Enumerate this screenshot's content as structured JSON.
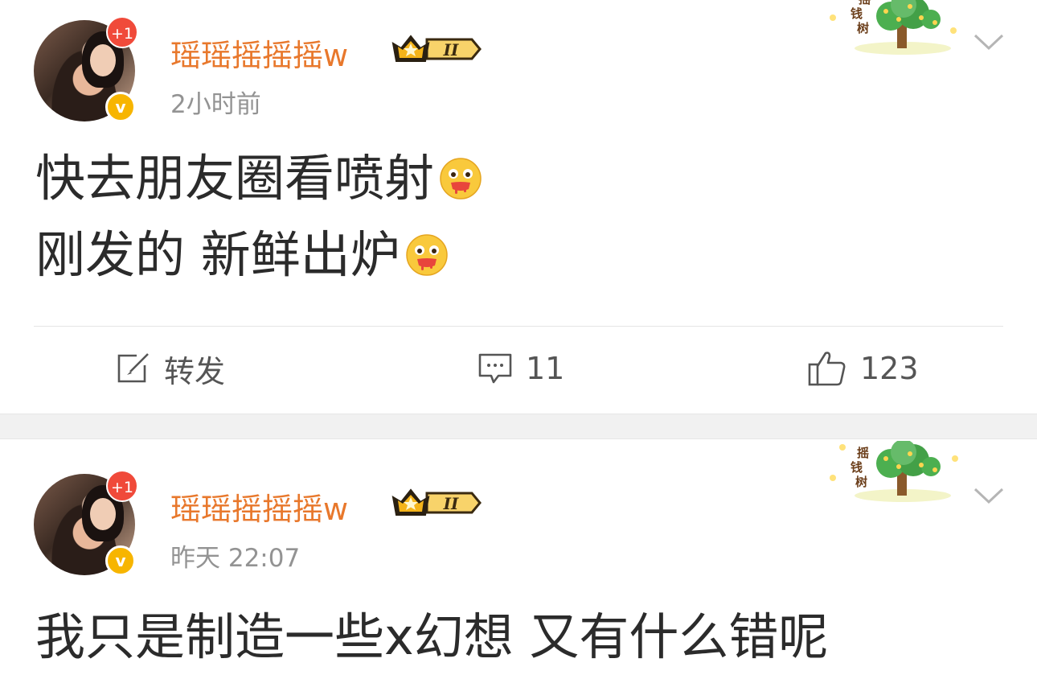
{
  "posts": [
    {
      "username": "瑶瑶摇摇摇w",
      "member_level": "II",
      "avatar_badge": "+1",
      "verified_mark": "v",
      "timestamp": "2小时前",
      "tree_label": [
        "摇",
        "钱",
        "树"
      ],
      "content_line1": "快去朋友圈看喷射",
      "content_line2": "刚发的 新鲜出炉",
      "emoji_icon": "drooling-face-emoji",
      "actions": {
        "repost_label": "转发",
        "comment_count": "11",
        "like_count": "123"
      }
    },
    {
      "username": "瑶瑶摇摇摇w",
      "member_level": "II",
      "avatar_badge": "+1",
      "verified_mark": "v",
      "timestamp": "昨天 22:07",
      "tree_label": [
        "摇",
        "钱",
        "树"
      ],
      "content_line1": "我只是制造一些x幻想 又有什么错呢"
    }
  ],
  "colors": {
    "username": "#e8782c",
    "timestamp": "#939393",
    "badge_red": "#f04a3a",
    "verified_gold": "#f7b500",
    "crown_gold": "#f5b41a"
  },
  "icons": [
    "edit-square-icon",
    "comment-bubble-icon",
    "thumbs-up-icon",
    "chevron-down-icon",
    "crown-icon",
    "money-tree-icon"
  ]
}
